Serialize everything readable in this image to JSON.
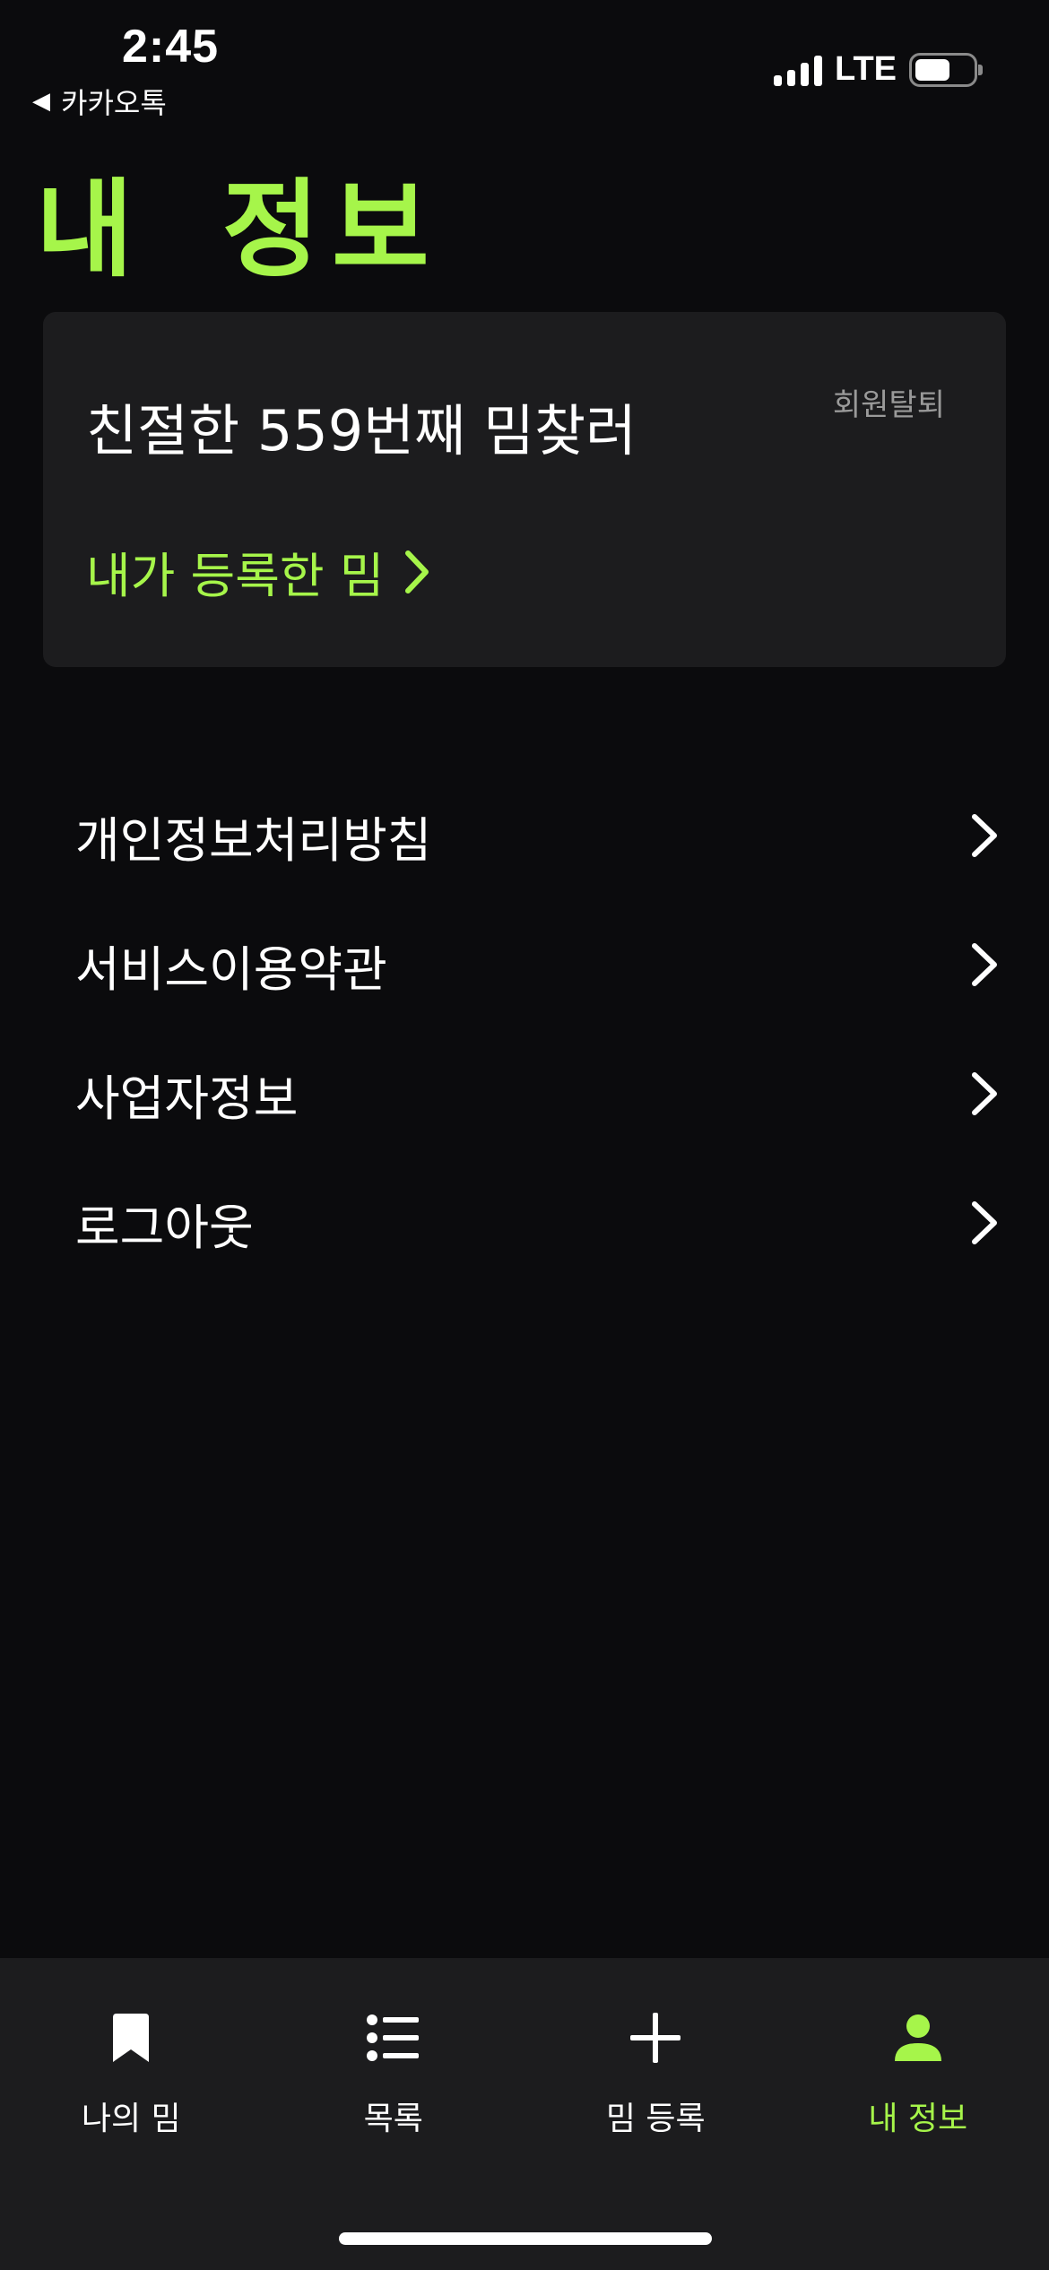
{
  "status_bar": {
    "time": "2:45",
    "back_app": "카카오톡",
    "network": "LTE"
  },
  "page": {
    "title": "내 정보"
  },
  "profile": {
    "nickname": "친절한 559번째 밈찾러",
    "withdraw_label": "회원탈퇴",
    "my_memes_label": "내가 등록한 밈"
  },
  "menu": {
    "items": [
      {
        "label": "개인정보처리방침"
      },
      {
        "label": "서비스이용약관"
      },
      {
        "label": "사업자정보"
      },
      {
        "label": "로그아웃"
      }
    ]
  },
  "tab_bar": {
    "tabs": [
      {
        "label": "나의 밈",
        "icon": "bookmark-icon"
      },
      {
        "label": "목록",
        "icon": "list-icon"
      },
      {
        "label": "밈 등록",
        "icon": "plus-icon"
      },
      {
        "label": "내 정보",
        "icon": "person-icon",
        "active": true
      }
    ]
  },
  "colors": {
    "background": "#0b0b0d",
    "surface": "#1c1c1e",
    "accent": "#a6f54a",
    "muted": "#9a9a9a"
  }
}
